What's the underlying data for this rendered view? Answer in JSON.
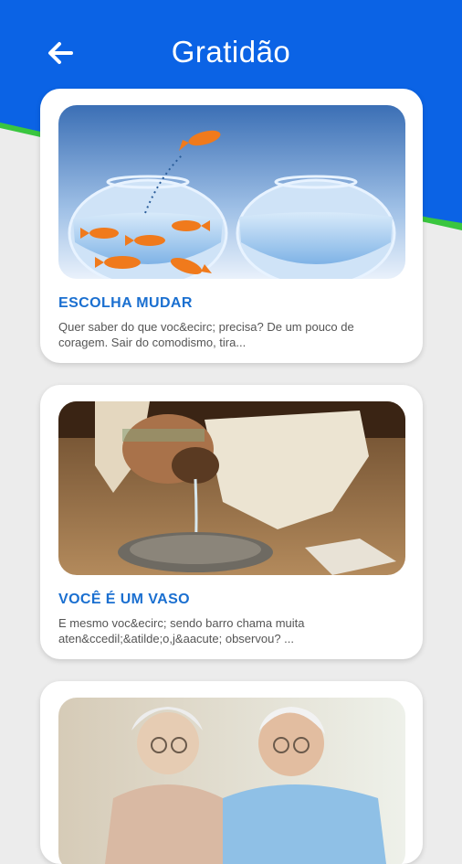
{
  "header": {
    "title": "Gratidão",
    "back_icon": "arrow-left-icon",
    "color": "#0b63e5",
    "accent_green": "#3ac63f"
  },
  "cards": [
    {
      "image": "goldfish-jumping-bowl-image",
      "title": "ESCOLHA MUDAR",
      "excerpt": "Quer saber do que voc&ecirc; precisa? De um pouco de coragem. Sair do comodismo, tira..."
    },
    {
      "image": "pouring-water-vase-image",
      "title": "VOCÊ É UM VASO",
      "excerpt": "E mesmo voc&ecirc; sendo barro chama muita aten&ccedil;&atilde;o,j&aacute; observou? ..."
    },
    {
      "image": "elderly-couple-image",
      "title": "",
      "excerpt": ""
    }
  ]
}
